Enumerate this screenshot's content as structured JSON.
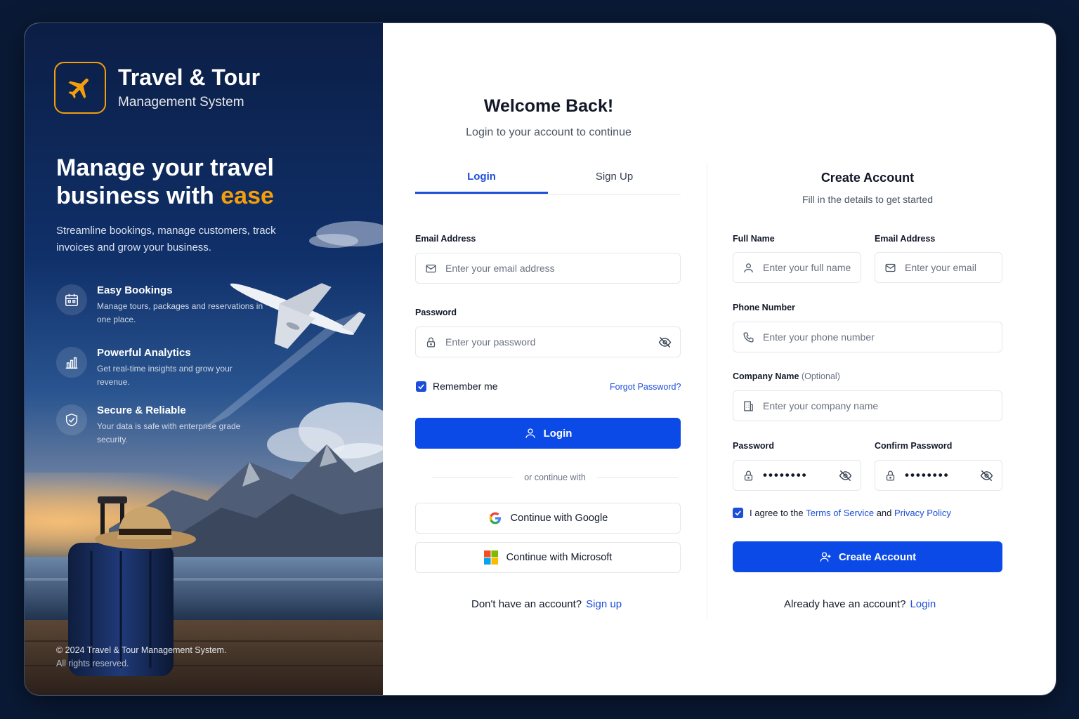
{
  "brand": {
    "title": "Travel & Tour",
    "subtitle": "Management System"
  },
  "hero": {
    "headline_start": "Manage your travel business with ",
    "headline_accent": "ease",
    "tagline": "Streamline bookings, manage customers, track invoices and grow your business.",
    "features": [
      {
        "icon": "calendar-icon",
        "title": "Easy Bookings",
        "desc": "Manage tours, packages and reservations in one place."
      },
      {
        "icon": "bar-chart-icon",
        "title": "Powerful Analytics",
        "desc": "Get real-time insights and grow your revenue."
      },
      {
        "icon": "shield-check-icon",
        "title": "Secure & Reliable",
        "desc": "Your data is safe with enterprise grade security."
      }
    ],
    "copyright_line1": "© 2024 Travel & Tour Management System.",
    "copyright_line2": "All rights reserved."
  },
  "login": {
    "title": "Welcome Back!",
    "subtitle": "Login to your account to continue",
    "tabs": [
      "Login",
      "Sign Up"
    ],
    "active_tab": "Login",
    "email_label": "Email Address",
    "email_placeholder": "Enter your email address",
    "password_label": "Password",
    "password_placeholder": "Enter your password",
    "remember_label": "Remember me",
    "remember_checked": true,
    "forgot_label": "Forgot Password?",
    "submit_label": "Login",
    "divider_label": "or continue with",
    "google_label": "Continue with Google",
    "microsoft_label": "Continue with Microsoft",
    "footer_text": "Don't have an account?",
    "footer_link": "Sign up"
  },
  "signup": {
    "title": "Create Account",
    "subtitle": "Fill in the details to get started",
    "fullname_label": "Full Name",
    "fullname_placeholder": "Enter your full name",
    "email_label": "Email Address",
    "email_placeholder": "Enter your email",
    "phone_label": "Phone Number",
    "phone_placeholder": "Enter your phone number",
    "company_label": "Company Name",
    "company_optional": "(Optional)",
    "company_placeholder": "Enter your company name",
    "password_label": "Password",
    "password_value": "••••••••",
    "confirm_label": "Confirm Password",
    "confirm_value": "••••••••",
    "terms_prefix": "I agree to the",
    "terms_link": "Terms of Service",
    "terms_and": "and",
    "privacy_link": "Privacy Policy",
    "terms_checked": true,
    "submit_label": "Create Account",
    "footer_text": "Already have an account?",
    "footer_link": "Login"
  },
  "colors": {
    "primary": "#0b4ae6",
    "accent": "#f59e0b",
    "link": "#1d4ed8",
    "background": "#0a1a36"
  }
}
